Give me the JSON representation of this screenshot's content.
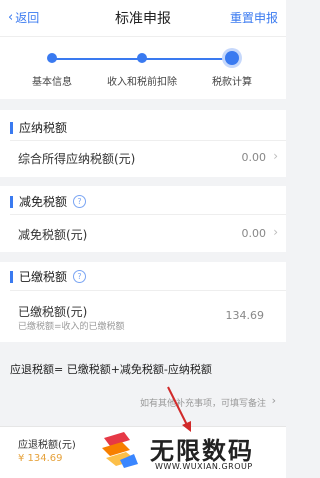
{
  "nav": {
    "back_label": "返回",
    "title": "标准申报",
    "reset_label": "重置申报"
  },
  "steps": [
    {
      "label": "基本信息",
      "state": "done"
    },
    {
      "label": "收入和税前扣除",
      "state": "done"
    },
    {
      "label": "税款计算",
      "state": "current"
    }
  ],
  "sections": {
    "payable": {
      "title": "应纳税额",
      "row_label": "综合所得应纳税额(元)",
      "row_value": "0.00"
    },
    "reduction": {
      "title": "减免税额",
      "row_label": "减免税额(元)",
      "row_value": "0.00"
    },
    "paid": {
      "title": "已缴税额",
      "row_label": "已缴税额(元)",
      "row_value": "134.69",
      "row_sub": "已缴税额=收入的已缴税额"
    }
  },
  "formula": "应退税额= 已缴税额+减免税额-应纳税额",
  "note": "如有其他补充事项，可填写备注",
  "bottom": {
    "label": "应退税额(元)",
    "amount": "¥ 134.69"
  },
  "watermark": {
    "brand": "无限数码",
    "url": "WWW.WUXIAN.GROUP"
  },
  "colors": {
    "accent": "#3a7af0",
    "amount": "#e6a23c"
  }
}
